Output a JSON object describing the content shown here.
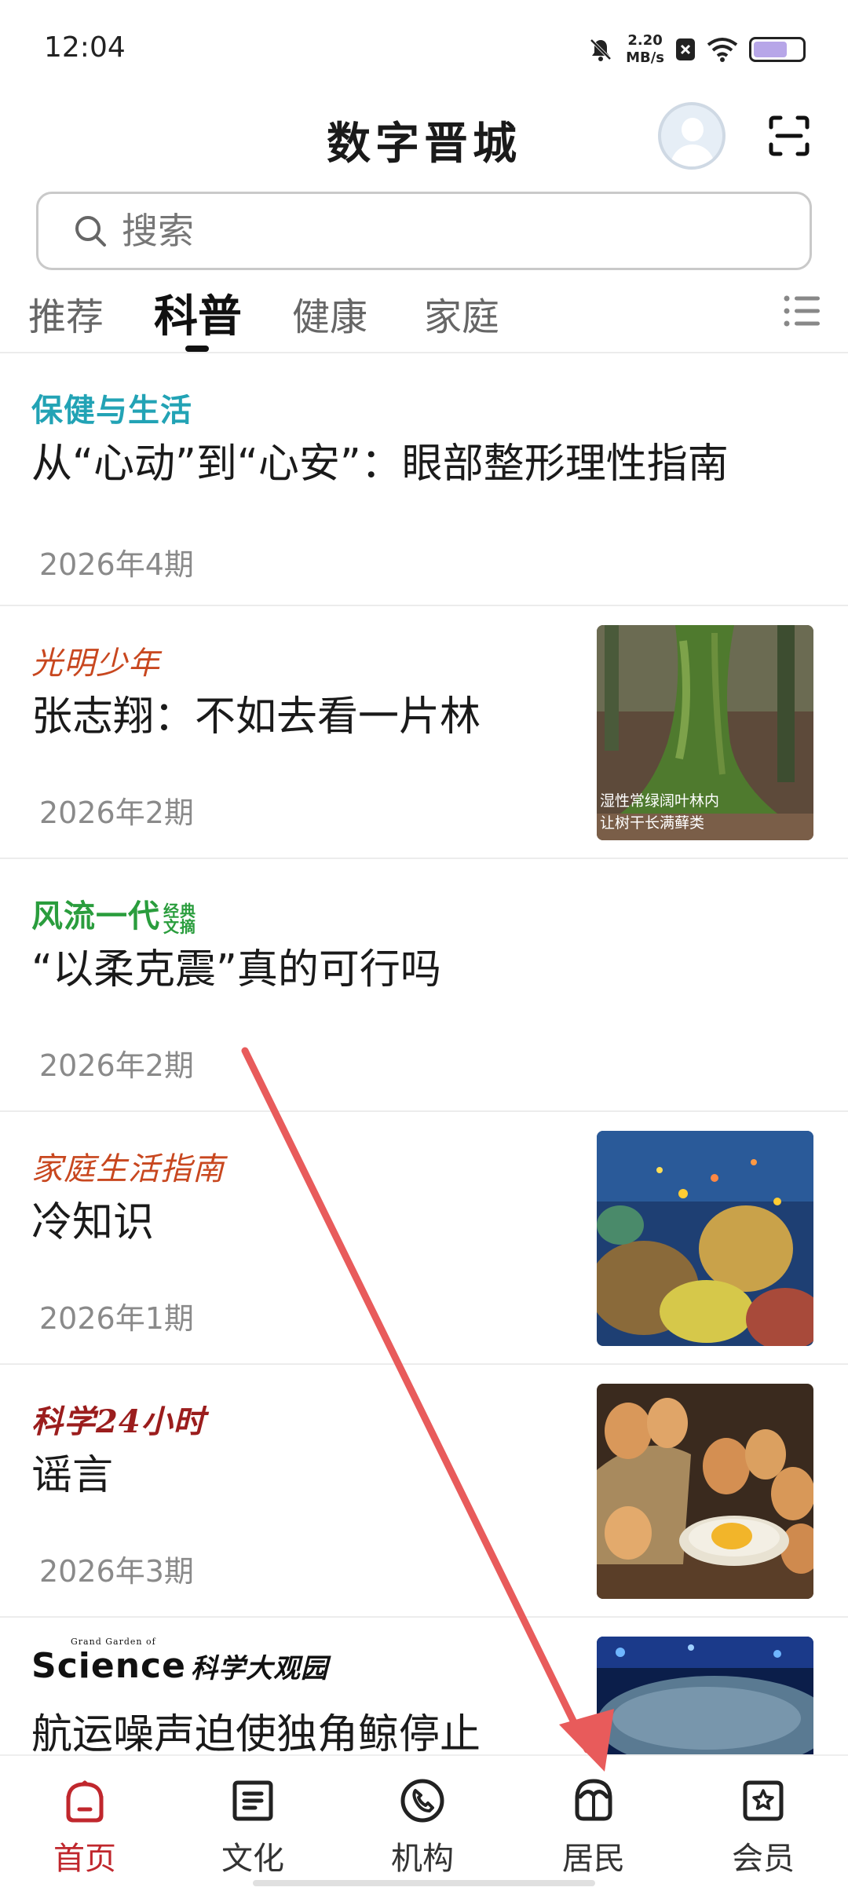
{
  "status_bar": {
    "time": "12:04",
    "net_speed_value": "2.20",
    "net_speed_unit": "MB/s",
    "battery_level": 0.7
  },
  "header": {
    "title": "数字晋城"
  },
  "search": {
    "placeholder": "搜索"
  },
  "tabs": [
    {
      "label": "推荐",
      "active": false
    },
    {
      "label": "科普",
      "active": true
    },
    {
      "label": "健康",
      "active": false
    },
    {
      "label": "家庭",
      "active": false
    }
  ],
  "feed": [
    {
      "source": "保健与生活",
      "title": "从“心动”到“心安”：眼部整形理性指南",
      "issue": "2026年4期",
      "has_image": false
    },
    {
      "source": "光明少年",
      "title": "张志翔：不如去看一片林",
      "issue": "2026年2期",
      "has_image": true,
      "image_caption": [
        "湿性常绿阔叶林内",
        "让树干长满藓类"
      ]
    },
    {
      "source": "风流一代",
      "source_sub": "经典文摘",
      "title": "“以柔克震”真的可行吗",
      "issue": "2026年2期",
      "has_image": false
    },
    {
      "source": "家庭生活指南",
      "title": "冷知识",
      "issue": "2026年1期",
      "has_image": true
    },
    {
      "source": "科学24小时",
      "title": "谣言",
      "issue": "2026年3期",
      "has_image": true
    },
    {
      "source": "Science",
      "source_sub": "科学大观园",
      "source_tiny": "Grand Garden of",
      "title": "航运噪声迫使独角鲸停止",
      "issue": "",
      "has_image": true
    }
  ],
  "bottom_nav": [
    {
      "label": "首页",
      "icon": "home-icon",
      "active": true
    },
    {
      "label": "文化",
      "icon": "culture-icon",
      "active": false
    },
    {
      "label": "机构",
      "icon": "phone-icon",
      "active": false
    },
    {
      "label": "居民",
      "icon": "resident-icon",
      "active": false
    },
    {
      "label": "会员",
      "icon": "member-star-icon",
      "active": false
    }
  ],
  "colors": {
    "accent": "#c0272d",
    "annotation_arrow": "#e85b5b"
  }
}
